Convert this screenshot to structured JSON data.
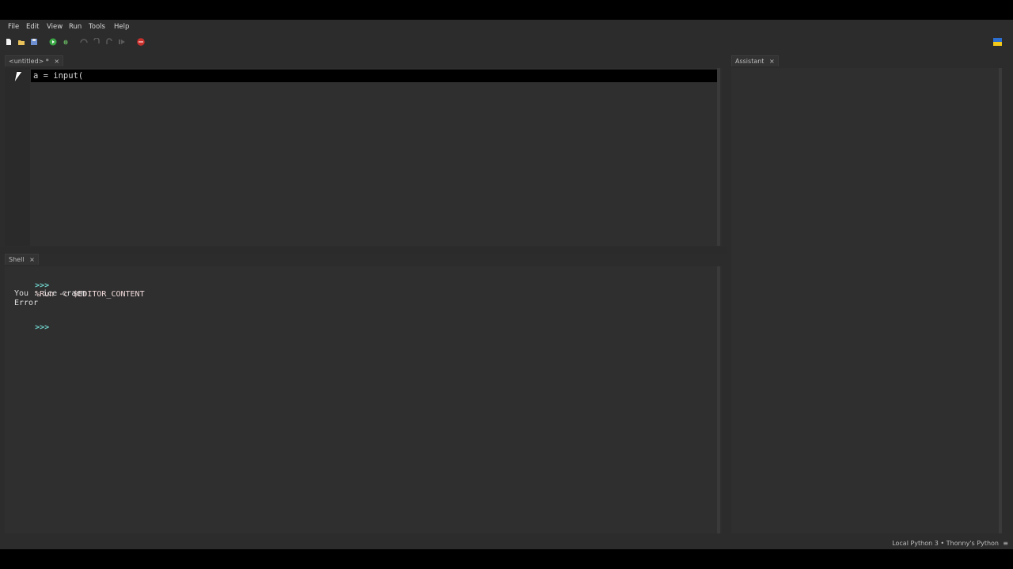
{
  "menu": [
    "File",
    "Edit",
    "View",
    "Run",
    "Tools",
    "Help"
  ],
  "editor": {
    "tab_label": "<untitled> *",
    "code_line": "a = input("
  },
  "shell": {
    "tab_label": "Shell",
    "prompt": ">>>",
    "command": "%Run -c $EDITOR_CONTENT",
    "output_line1": "You : ice craem",
    "output_line2": "Error",
    "prompt2": ">>>"
  },
  "assistant": {
    "tab_label": "Assistant"
  },
  "statusbar": {
    "interpreter": "Local Python 3  •  Thonny's Python",
    "menu_glyph": "≡"
  },
  "icons": {
    "close": "×",
    "new": "new-file-icon",
    "open": "open-folder-icon",
    "save": "save-icon",
    "run": "run-icon",
    "debug": "debug-icon",
    "step_over": "step-over-icon",
    "step_into": "step-into-icon",
    "step_out": "step-out-icon",
    "resume": "resume-icon",
    "stop": "stop-icon",
    "flag": "ukraine-flag-icon"
  },
  "colors": {
    "background": "#2c2c2c",
    "prompt": "#6fd0c9",
    "command": "#f0d9d9",
    "stop": "#c9302c"
  }
}
